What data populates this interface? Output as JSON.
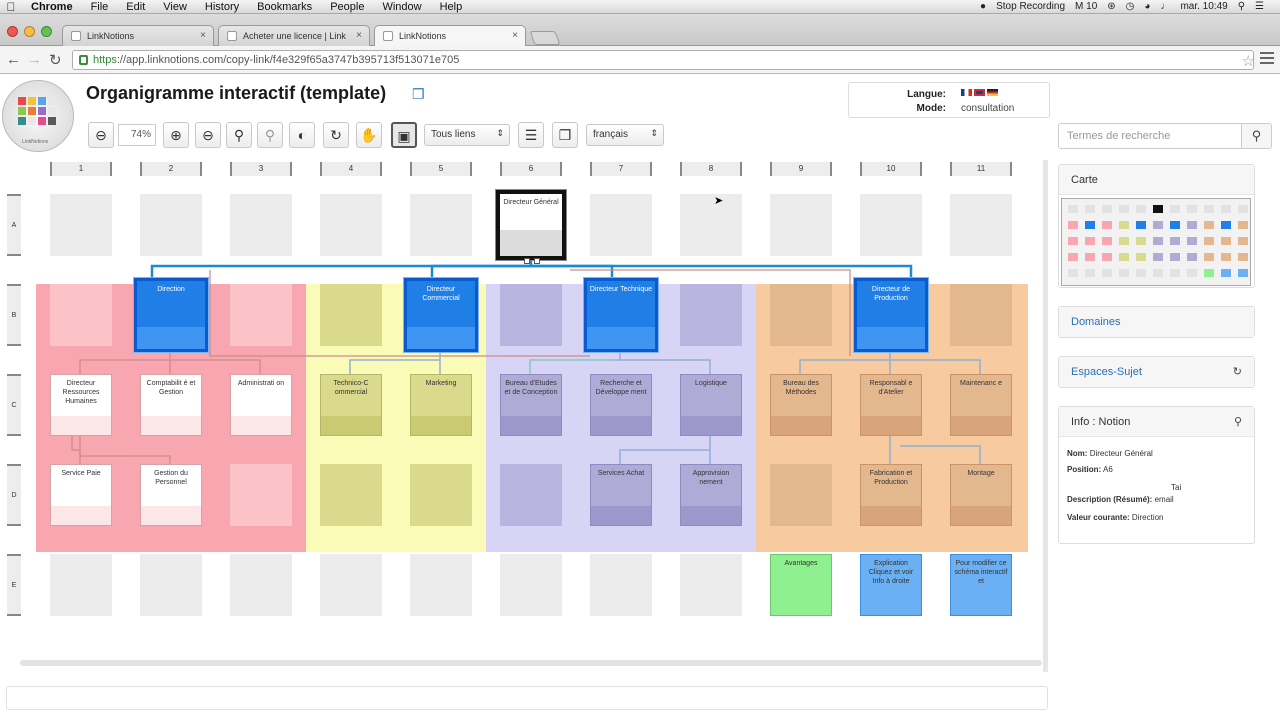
{
  "menubar": {
    "apple": "",
    "items": [
      "Chrome",
      "File",
      "Edit",
      "View",
      "History",
      "Bookmarks",
      "People",
      "Window",
      "Help"
    ],
    "status": {
      "recording": "Stop Recording",
      "m": "M 10",
      "clock": "mar. 10:49"
    }
  },
  "tabs": [
    {
      "label": "LinkNotions",
      "active": false
    },
    {
      "label": "Acheter une licence | Link",
      "active": false
    },
    {
      "label": "LinkNotions",
      "active": true
    }
  ],
  "address": {
    "scheme": "https",
    "rest": "://app.linknotions.com/copy-link/f4e329f65a3747b395713f513071e705"
  },
  "page": {
    "title": "Organigramme interactif (template)",
    "logo_caption": "LinkNotions",
    "langue_label": "Langue:",
    "mode_label": "Mode:",
    "mode_value": "consultation",
    "flags": [
      "#ce2f36",
      "#1c3f8c",
      "#222222"
    ]
  },
  "toolbar": {
    "zoom_value": "74%",
    "links_select": "Tous liens",
    "language_select": "français"
  },
  "grid": {
    "cols": [
      "1",
      "2",
      "3",
      "4",
      "5",
      "6",
      "7",
      "8",
      "9",
      "10",
      "11"
    ],
    "rows": [
      "A",
      "B",
      "C",
      "D",
      "E"
    ]
  },
  "cards": {
    "directeur_general": "Directeur Général",
    "direction": "Direction",
    "dir_commercial": "Directeur Commercial",
    "dir_technique": "Directeur Technique",
    "dir_production": "Directeur de Production",
    "drh": "Directeur Ressources Humaines",
    "comptabilite": "Comptabilit é et Gestion",
    "administration": "Administrati on",
    "technico": "Technico-C ommercial",
    "marketing": "Marketing",
    "bureau_etudes": "Bureau d'Etudes et de Conception",
    "recherche": "Recherche et Développe ment",
    "logistique": "Logistique",
    "bureau_methodes": "Bureau des Méthodes",
    "resp_atelier": "Responsabl e d'Atelier",
    "maintenance": "Maintenanc e",
    "service_paie": "Service Paie",
    "gestion_personnel": "Gestion du Personnel",
    "services_achat": "Services Achat",
    "approvisionnement": "Approvision nement",
    "fabrication": "Fabrication et Production",
    "montage": "Montage",
    "avantages": "Avantages",
    "explication": "Explication Cliquez et voir Info à droite",
    "pour_modifier": "Pour modifier ce schéma interactif et"
  },
  "colors": {
    "zone_pink": "#f8a7b0",
    "zone_yellow": "#fbfbb8",
    "zone_purple": "#d7d4f5",
    "zone_orange": "#f7ca9f",
    "link_blue": "#1a8ad4"
  },
  "sidebar": {
    "search_placeholder": "Termes de recherche",
    "carte": "Carte",
    "domaines": "Domaines",
    "espaces": "Espaces-Sujet",
    "info_title": "Info : Notion",
    "info": {
      "nom_label": "Nom:",
      "nom": "Directeur Général",
      "position_label": "Position:",
      "position": "A6",
      "tai": "Tai",
      "desc_label": "Description (Résumé):",
      "desc": "email",
      "valeur_label": "Valeur courante:",
      "valeur": "Direction"
    }
  }
}
